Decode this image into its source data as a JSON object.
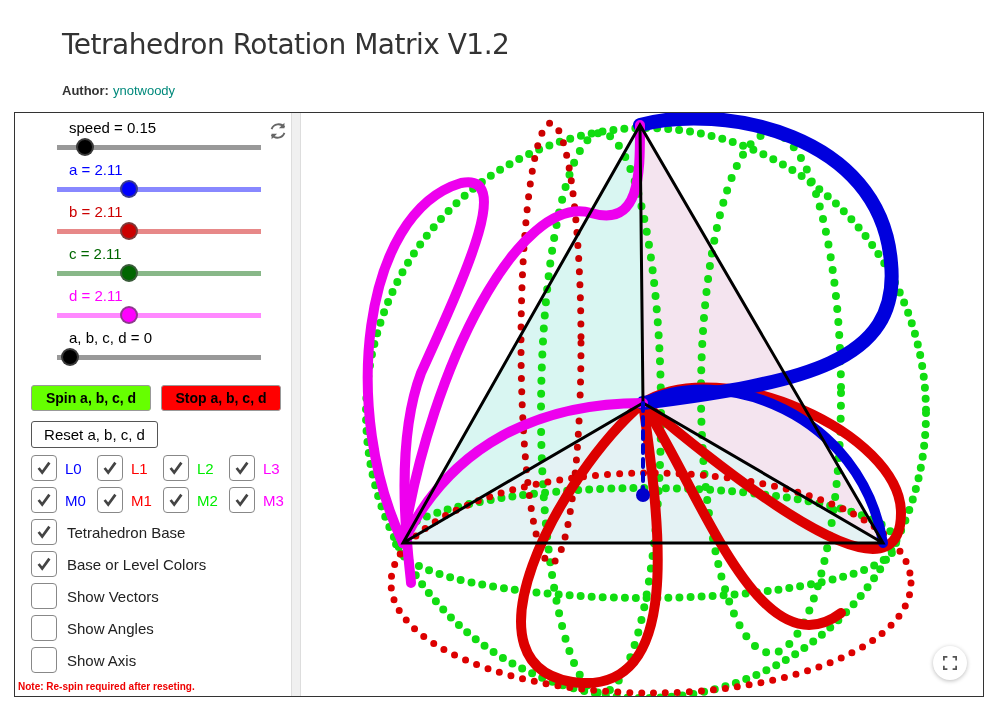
{
  "title": "Tetrahedron Rotation Matrix V1.2",
  "author": {
    "label": "Author:",
    "name": "ynotwoody"
  },
  "sliders": [
    {
      "label": "speed = 0.15",
      "level": 0.1,
      "color": "#000000"
    },
    {
      "label": "a = 2.11",
      "level": 0.34,
      "color": "#0000ff"
    },
    {
      "label": "b = 2.11",
      "level": 0.34,
      "color": "#cc0000"
    },
    {
      "label": "c = 2.11",
      "level": 0.34,
      "color": "#006600"
    },
    {
      "label": "d = 2.11",
      "level": 0.34,
      "color": "#ff00ff"
    },
    {
      "label": "a, b, c, d = 0",
      "level": 0.02,
      "color": "#000000"
    }
  ],
  "buttons": [
    {
      "label": "Spin a, b, c, d",
      "color": "#66ff00"
    },
    {
      "label": "Stop a, b, c, d",
      "color": "#ff0000"
    }
  ],
  "reset_button": "Reset a, b, c, d",
  "layer_toggles": [
    {
      "label": "L0",
      "checked": true,
      "color": "#0000ff"
    },
    {
      "label": "L1",
      "checked": true,
      "color": "#ff0000"
    },
    {
      "label": "L2",
      "checked": true,
      "color": "#00ee00"
    },
    {
      "label": "L3",
      "checked": true,
      "color": "#ff00ff"
    },
    {
      "label": "M0",
      "checked": true,
      "color": "#0000ff"
    },
    {
      "label": "M1",
      "checked": true,
      "color": "#ff0000"
    },
    {
      "label": "M2",
      "checked": true,
      "color": "#00ee00"
    },
    {
      "label": "M3",
      "checked": true,
      "color": "#ff00ff"
    }
  ],
  "options": [
    {
      "label": "Tetrahedron Base",
      "checked": true
    },
    {
      "label": "Base or Level Colors",
      "checked": true
    },
    {
      "label": "Show Vectors",
      "checked": false
    },
    {
      "label": "Show Angles",
      "checked": false
    },
    {
      "label": "Show Axis",
      "checked": false
    }
  ],
  "note": "Note: Re-spin required after reseting."
}
